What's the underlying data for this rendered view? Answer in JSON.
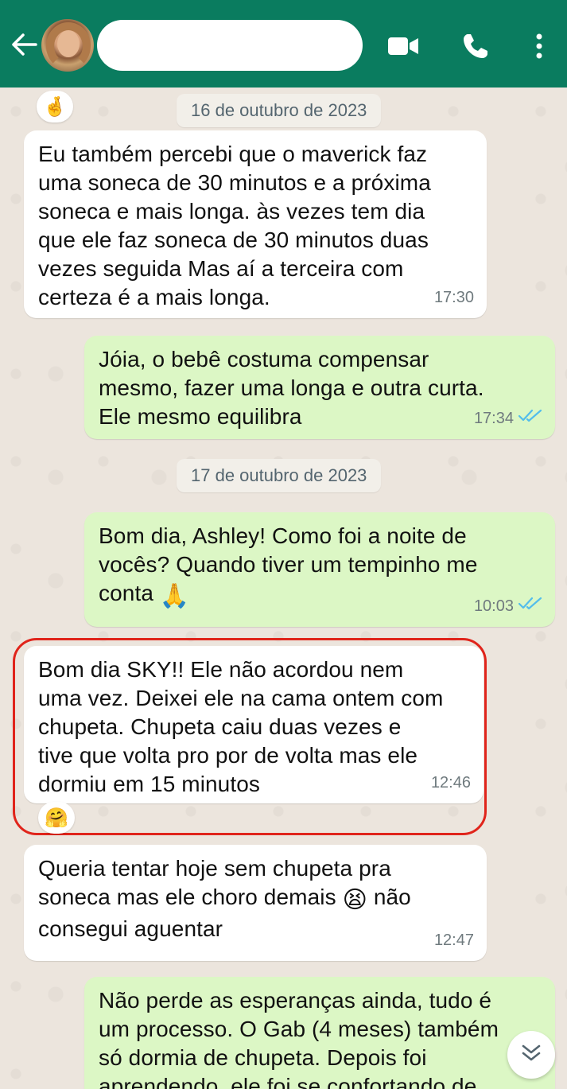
{
  "header": {
    "contact_name": "",
    "icons": [
      "back-arrow-icon",
      "video-call-icon",
      "voice-call-icon",
      "more-options-icon"
    ]
  },
  "colors": {
    "header": "#0a7c5f",
    "incoming_bubble": "#ffffff",
    "outgoing_bubble": "#dcf7c5",
    "read_ticks": "#53bdeb",
    "highlight_outline": "#e0241b"
  },
  "reaction_top": "🤞",
  "dates": {
    "first": "16 de outubro de 2023",
    "second": "17 de outubro de 2023"
  },
  "messages": [
    {
      "direction": "in",
      "text": "Eu também percebi que o maverick faz\numa soneca de 30 minutos e a próxima\nsoneca e mais longa. às vezes tem dia\nque ele faz soneca de 30 minutos duas\nvezes seguida Mas aí a terceira com\ncerteza é a mais longa.",
      "time": "17:30"
    },
    {
      "direction": "out",
      "text": "Jóia, o bebê costuma compensar\nmesmo, fazer uma longa e outra curta.\nEle mesmo equilibra",
      "time": "17:34",
      "status": "read"
    },
    {
      "direction": "out",
      "text_before": "Bom dia, Ashley! Como foi a noite de\nvocês? Quando tiver um tempinho me\nconta ",
      "emoji": "🙏",
      "time": "10:03",
      "status": "read"
    },
    {
      "direction": "in",
      "text": "Bom dia SKY!! Ele não acordou nem\numa vez. Deixei ele na cama ontem com\nchupeta. Chupeta caiu duas vezes e\ntive que volta pro por de volta mas ele\ndormiu em 15 minutos",
      "time": "12:46",
      "reaction": "🤗"
    },
    {
      "direction": "in",
      "text_before": "Queria tentar hoje sem chupeta pra\nsoneca mas ele choro demais ",
      "emoji": "😫",
      "text_after": " não\nconsegui aguentar",
      "time": "12:47"
    },
    {
      "direction": "out",
      "text": "Não perde as esperanças ainda, tudo é\num processo. O Gab (4 meses) também\nsó dormia de chupeta. Depois foi\naprendendo, ele foi se confortando de"
    }
  ]
}
